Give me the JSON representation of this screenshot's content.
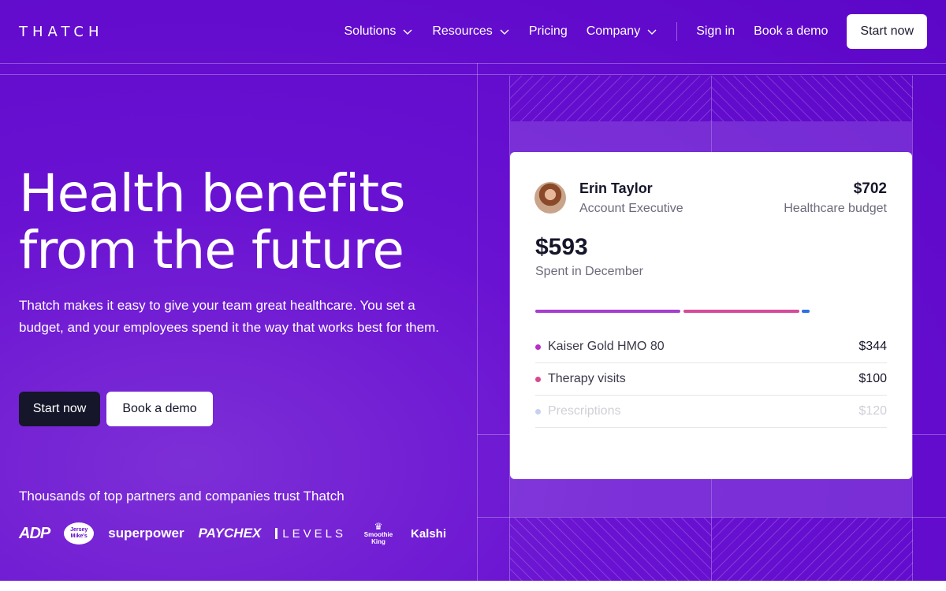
{
  "nav": {
    "logo": "THATCH",
    "items": [
      {
        "label": "Solutions",
        "dropdown": true
      },
      {
        "label": "Resources",
        "dropdown": true
      },
      {
        "label": "Pricing",
        "dropdown": false
      },
      {
        "label": "Company",
        "dropdown": true
      }
    ],
    "sign_in": "Sign in",
    "book_demo": "Book a demo",
    "start_now": "Start now"
  },
  "hero": {
    "title_line1": "Health benefits",
    "title_line2": "from the future",
    "subtitle": "Thatch makes it easy to give your team great healthcare. You set a budget, and your employees spend it the way that works best for them.",
    "primary_cta": "Start now",
    "secondary_cta": "Book a demo",
    "trust_text": "Thousands of top partners and companies trust Thatch",
    "logos": [
      "ADP",
      "Jersey Mike's",
      "superpower",
      "PAYCHEX",
      "LEVELS",
      "Smoothie King",
      "Kalshi"
    ]
  },
  "card": {
    "name": "Erin Taylor",
    "role": "Account Executive",
    "budget": "$702",
    "budget_label": "Healthcare budget",
    "spent": "$593",
    "spent_label": "Spent in December",
    "items": [
      {
        "label": "Kaiser Gold HMO 80",
        "amount": "$344",
        "color": "#b52fc6",
        "faded": false
      },
      {
        "label": "Therapy visits",
        "amount": "$100",
        "color": "#d9488f",
        "faded": false
      },
      {
        "label": "Prescriptions",
        "amount": "$120",
        "color": "#c7d0f0",
        "faded": true
      }
    ],
    "bar_colors": [
      "#a43fd0",
      "#d64a9a",
      "#2f6fe0"
    ]
  },
  "colors": {
    "background": "#6a12d2",
    "dark_button": "#15162a"
  }
}
